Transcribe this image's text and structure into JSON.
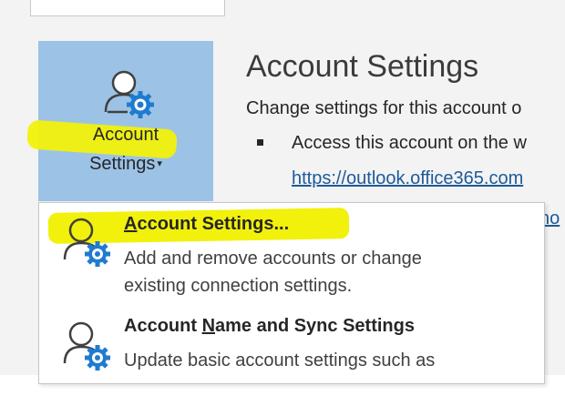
{
  "ribbon": {
    "account_settings_button": {
      "label_line1": "Account",
      "label_line2": "Settings",
      "caret": "▾",
      "icon": "person-gear-icon",
      "background": "#9cc3e6"
    }
  },
  "info_panel": {
    "title": "Account Settings",
    "description": "Change settings for this account o",
    "bullet_text": "Access this account on the w",
    "bullet_link": "https://outlook.office365.com",
    "partial_link": "ho"
  },
  "dropdown": {
    "items": [
      {
        "title_mnemonic": "A",
        "title_rest": "ccount Settings...",
        "desc_line1": "Add and remove accounts or change",
        "desc_line2": "existing connection settings.",
        "icon": "person-gear-icon"
      },
      {
        "title_before": "Account ",
        "title_mnemonic": "N",
        "title_rest": "ame and Sync Settings",
        "desc_line1": "Update basic account settings such as",
        "icon": "person-gear-icon"
      }
    ]
  },
  "colors": {
    "highlighter": "#f1f10b",
    "link": "#1e5a9a",
    "gear": "#1f7bd0"
  }
}
